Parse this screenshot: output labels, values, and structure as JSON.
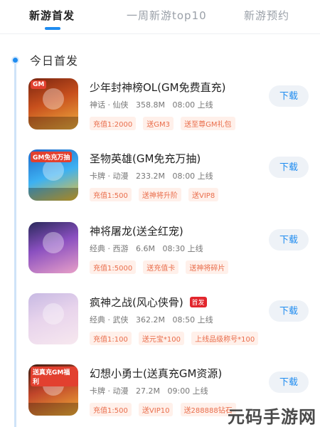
{
  "tabs": [
    {
      "label": "新游首发"
    },
    {
      "label": "一周新游top10"
    },
    {
      "label": "新游预约"
    }
  ],
  "section": {
    "title": "今日首发"
  },
  "games": [
    {
      "name": "少年封神榜OL(GM免费直充)",
      "category": "神话 · 仙侠",
      "size": "358.8M",
      "time": "08:00 上线",
      "tags": [
        "充值1:2000",
        "送GM3",
        "送至尊GM礼包"
      ],
      "thumb_text": "GM",
      "badge": ""
    },
    {
      "name": "圣物英雄(GM免充万抽)",
      "category": "卡牌 · 动漫",
      "size": "233.2M",
      "time": "08:00 上线",
      "tags": [
        "充值1:500",
        "送神将升阶",
        "送VIP8"
      ],
      "thumb_text": "GM免充万抽",
      "badge": ""
    },
    {
      "name": "神将屠龙(送全红宠)",
      "category": "经典 · 西游",
      "size": "6.6M",
      "time": "08:30 上线",
      "tags": [
        "充值1:5000",
        "送充值卡",
        "送神将碎片"
      ],
      "thumb_text": "",
      "badge": ""
    },
    {
      "name": "疯神之战(风心侠骨)",
      "category": "经典 · 武侠",
      "size": "362.2M",
      "time": "08:50 上线",
      "tags": [
        "充值1:100",
        "送元宝*100",
        "上线品级称号*100"
      ],
      "thumb_text": "",
      "badge": "首发"
    },
    {
      "name": "幻想小勇士(送真充GM资源)",
      "category": "卡牌 · 动漫",
      "size": "27.2M",
      "time": "09:00 上线",
      "tags": [
        "充值1:500",
        "送VIP10",
        "送288888钻石"
      ],
      "thumb_text": "送真充GM福利",
      "badge": ""
    }
  ],
  "download_label": "下载",
  "watermark": "元码手游网",
  "colors": {
    "accent": "#1f8cf0",
    "tag_text": "#e96d4b",
    "tag_bg": "#fff0ea",
    "badge_bg": "#e2262d"
  }
}
